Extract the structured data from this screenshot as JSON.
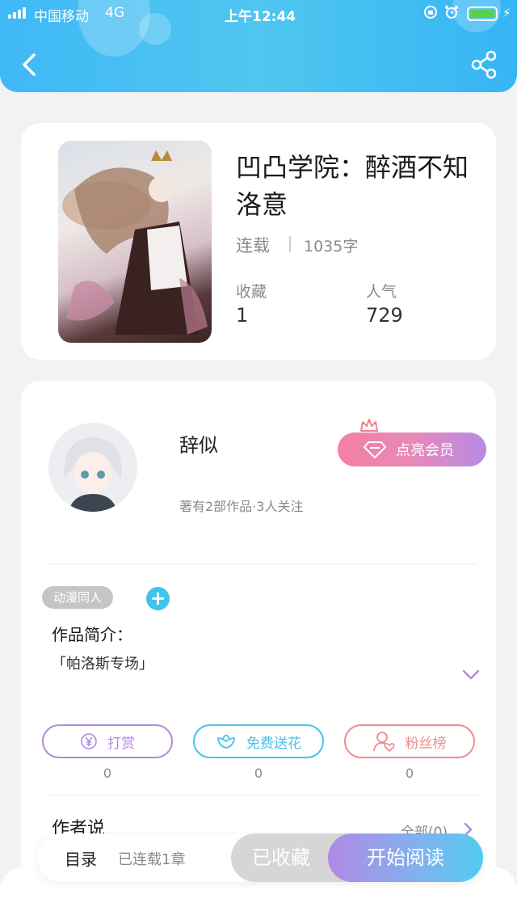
{
  "status_bar": {
    "carrier": "中国移动",
    "network": "4G",
    "time": "上午12:44"
  },
  "header": {
    "back_icon": "chevron-left-icon",
    "share_icon": "share-icon"
  },
  "book": {
    "title": "凹凸学院：醉酒不知洛意",
    "status": "连载",
    "word_count": "1035字",
    "stats": [
      {
        "label": "收藏",
        "value": "1"
      },
      {
        "label": "人气",
        "value": "729"
      }
    ]
  },
  "author": {
    "name": "辞似",
    "meta": "著有2部作品·3人关注",
    "vip_button": "点亮会员"
  },
  "tag": {
    "label": "动漫同人",
    "add_symbol": "+"
  },
  "intro": {
    "title": "作品简介：",
    "text": "「帕洛斯专场」"
  },
  "actions": [
    {
      "label": "打赏",
      "count": "0",
      "icon": "yen-icon",
      "color": "#b18ae0"
    },
    {
      "label": "免费送花",
      "count": "0",
      "icon": "flower-icon",
      "color": "#44c3ea"
    },
    {
      "label": "粉丝榜",
      "count": "0",
      "icon": "fans-icon",
      "color": "#f08c8c"
    }
  ],
  "announcement": {
    "title": "作者说",
    "all_label": "全部(0)"
  },
  "bottom_bar": {
    "toc_label": "目录",
    "chapter_count": "已连载1章",
    "favorited_label": "已收藏",
    "read_label": "开始阅读"
  },
  "colors": {
    "header": "#3fb8f6",
    "accent_blue": "#3fc4ea",
    "accent_purple": "#b08ae6"
  }
}
